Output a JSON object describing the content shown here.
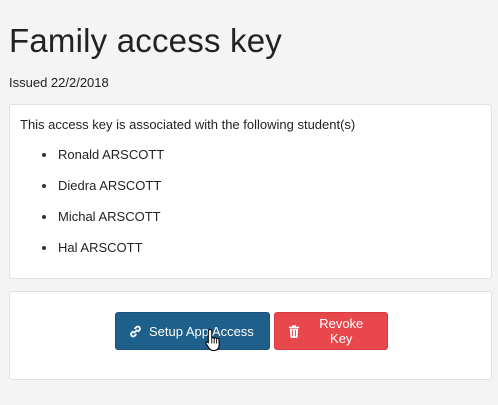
{
  "page": {
    "title": "Family access key",
    "issued": "Issued 22/2/2018"
  },
  "students_panel": {
    "intro": "This access key is associated with the following student(s)",
    "students": [
      "Ronald ARSCOTT",
      "Diedra ARSCOTT",
      "Michal ARSCOTT",
      "Hal ARSCOTT"
    ]
  },
  "actions": {
    "setup_label": "Setup App Access",
    "revoke_label": "Revoke Key"
  },
  "icons": {
    "setup": "link-icon",
    "revoke": "trash-icon",
    "pointer": "hand-cursor-icon"
  },
  "colors": {
    "setup_button": "#1f5f8b",
    "revoke_button": "#e8474c",
    "background": "#f4f4f4"
  }
}
